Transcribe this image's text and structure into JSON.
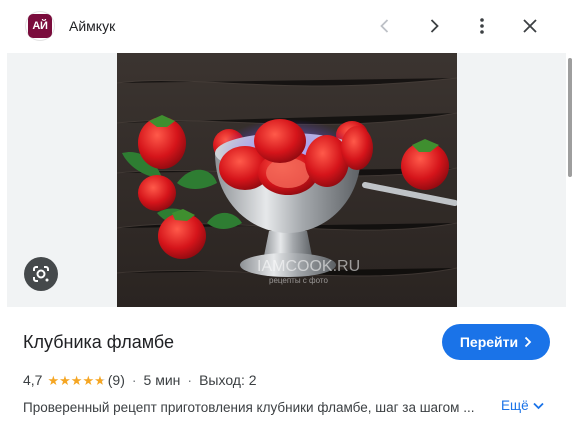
{
  "header": {
    "logo_text": "АЙ",
    "site_name": "Аймкук"
  },
  "image": {
    "watermark": "IAMCOOK.RU",
    "watermark_sub": "рецепты с фото"
  },
  "result": {
    "title": "Клубника фламбе",
    "visit_label": "Перейти",
    "rating": "4,7",
    "rating_value": 4.7,
    "reviews": "(9)",
    "time": "5 мин",
    "yield": "Выход: 2",
    "description": "Проверенный рецепт приготовления клубники фламбе, шаг за шагом ...",
    "more_label": "Ещё"
  },
  "colors": {
    "accent": "#1a73e8",
    "star": "#f5a623",
    "logo_bg": "#7a0c3c"
  },
  "icons": [
    "previous-icon",
    "next-icon",
    "more-vert-icon",
    "close-icon",
    "lens-icon",
    "chevron-right-icon",
    "chevron-down-icon",
    "star-icon"
  ]
}
